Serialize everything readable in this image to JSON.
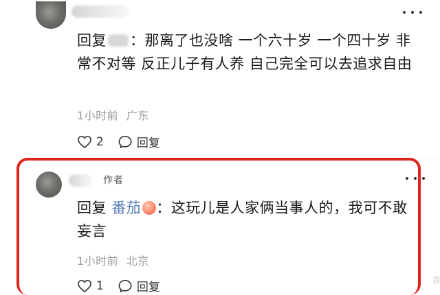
{
  "comments": [
    {
      "reply_prefix": "回复",
      "colon": "：",
      "content": "那离了也没啥 一个六十岁 一个四十岁 非常不对等 反正儿子有人养 自己完全可以去追求自由",
      "time": "1小时前",
      "location": "广东",
      "like_count": "2",
      "reply_label": "回复"
    },
    {
      "author_badge": "作者",
      "reply_prefix": "回复",
      "mention": "番茄",
      "colon": "：",
      "content": "这玩儿是人家俩当事人的，我可不敢妄言",
      "time": "1小时前",
      "location": "北京",
      "like_count": "1",
      "reply_label": "回复"
    }
  ],
  "watermark": "百",
  "colors": {
    "highlight": "#e0231c",
    "meta_gray": "#9a9a9a",
    "mention_blue": "#5a7fb8"
  },
  "icons": [
    "more-icon",
    "heart-icon",
    "comment-bubble-icon",
    "peach-emoji-icon"
  ]
}
